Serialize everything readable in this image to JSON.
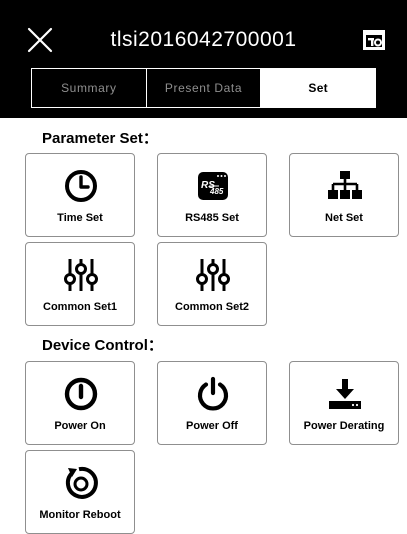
{
  "header": {
    "title": "tlsi2016042700001",
    "close_icon": "close-icon",
    "calendar_icon": "calendar-icon"
  },
  "tabs": [
    {
      "label": "Summary",
      "active": false
    },
    {
      "label": "Present Data",
      "active": false
    },
    {
      "label": "Set",
      "active": true
    }
  ],
  "parameter_set": {
    "title": "Parameter Set：",
    "items": [
      {
        "label": "Time Set",
        "icon": "clock-icon"
      },
      {
        "label": "RS485 Set",
        "icon": "rs485-icon",
        "icon_text": "RS485"
      },
      {
        "label": "Net Set",
        "icon": "network-icon"
      },
      {
        "label": "Common Set1",
        "icon": "sliders-icon"
      },
      {
        "label": "Common Set2",
        "icon": "sliders-icon"
      }
    ]
  },
  "device_control": {
    "title": "Device Control：",
    "items": [
      {
        "label": "Power On",
        "icon": "power-on-icon"
      },
      {
        "label": "Power Off",
        "icon": "power-off-icon"
      },
      {
        "label": "Power Derating",
        "icon": "download-icon"
      },
      {
        "label": "Monitor Reboot",
        "icon": "reboot-icon"
      }
    ]
  },
  "colors": {
    "header_bg": "#000000",
    "tile_border": "#8f8f8f",
    "inactive_tab_text": "#8f8f8f"
  }
}
